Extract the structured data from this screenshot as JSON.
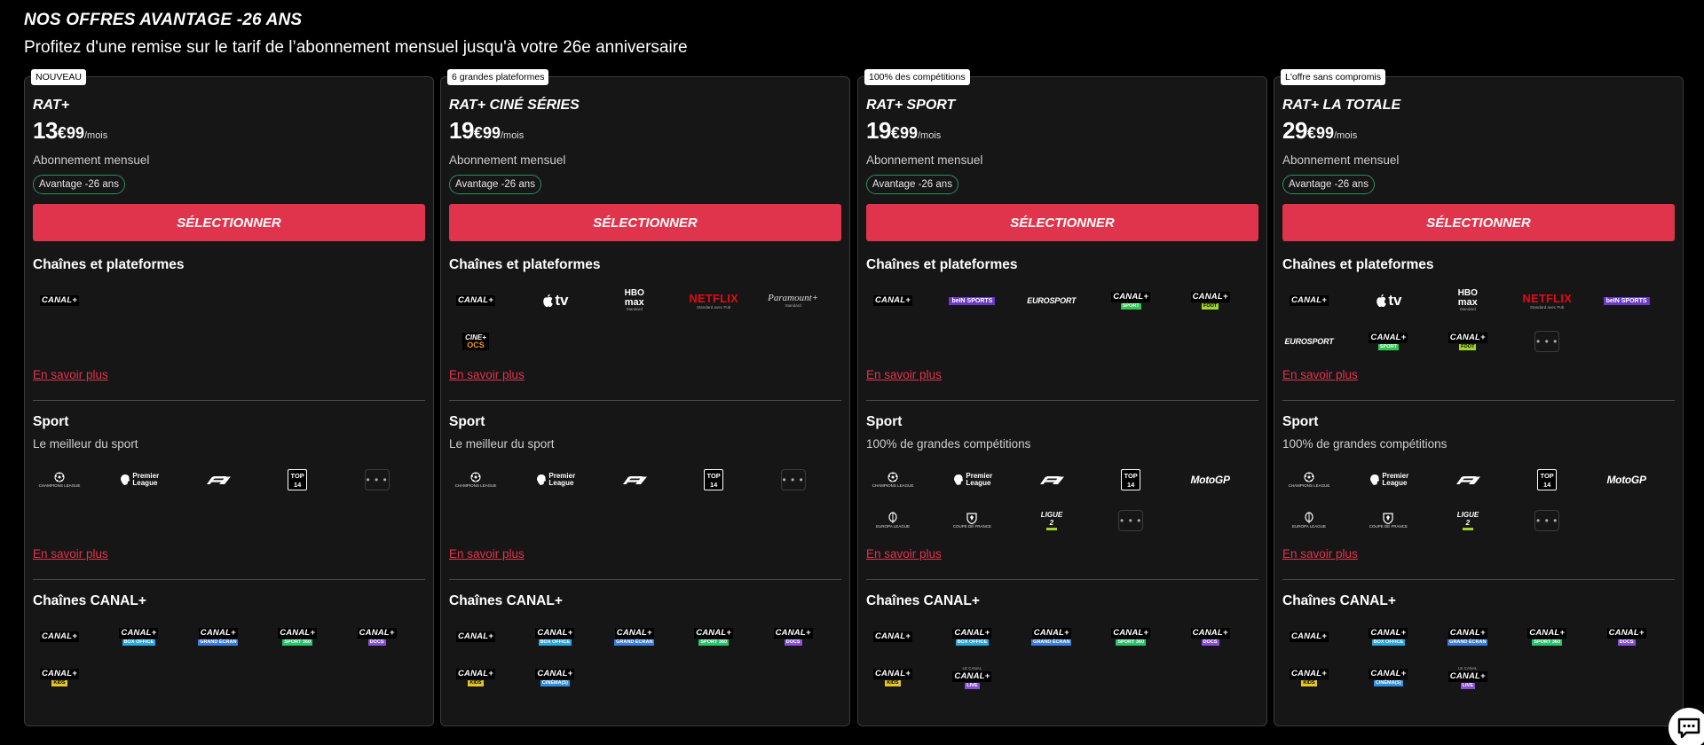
{
  "header": {
    "title": "NOS OFFRES AVANTAGE -26 ANS",
    "subtitle": "Profitez d'une remise sur le tarif de l’abonnement mensuel jusqu'à votre 26e anniversaire"
  },
  "common": {
    "billing": "Abonnement mensuel",
    "advantage": "Avantage -26 ans",
    "select": "SÉLECTIONNER",
    "channels_title": "Chaînes et plateformes",
    "sport_title": "Sport",
    "canal_title": "Chaînes CANAL+",
    "more": "En savoir plus",
    "price_unit": "€",
    "price_per": "/mois"
  },
  "plans": [
    {
      "badge": "NOUVEAU",
      "name": "RAT+",
      "price_int": "13",
      "price_dec": "99",
      "sport_sub": "Le meilleur du sport"
    },
    {
      "badge": "6 grandes plateformes",
      "name": "RAT+ CINÉ SÉRIES",
      "price_int": "19",
      "price_dec": "99",
      "sport_sub": "Le meilleur du sport"
    },
    {
      "badge": "100% des compétitions",
      "name": "RAT+ SPORT",
      "price_int": "19",
      "price_dec": "99",
      "sport_sub": "100% de grandes compétitions"
    },
    {
      "badge": "L'offre sans compromis",
      "name": "RAT+ LA TOTALE",
      "price_int": "29",
      "price_dec": "99",
      "sport_sub": "100% de grandes compétitions"
    }
  ],
  "logos": {
    "canal": "CANAL+",
    "box_office": "BOX OFFICE",
    "grand_ecran": "GRAND ÉCRAN",
    "sport360": "SPORT 360",
    "docs": "DOCS",
    "kids": "KIDS",
    "cinemas": "CINÉMA(S)",
    "live": "LIVE",
    "sport": "SPORT",
    "foot": "FOOT",
    "appletv": "tv",
    "hbo": "HBO",
    "max": "max",
    "standard": "Standard",
    "netflix": "NETFLIX",
    "netflix_sub": "Standard avec Pub",
    "paramount": "Paramount+",
    "ocs_top": "CINE+",
    "ocs": "OCS",
    "beinsports": "beIN SPORTS",
    "eurosport": "EUROSPORT",
    "champions": "CHAMPIONS LEAGUE",
    "premier": "Premier League",
    "f1": "F1",
    "top14": "TOP 14",
    "motogp": "MotoGP",
    "europa": "EUROPA LEAGUE",
    "coupe": "COUPE DE FRANCE",
    "ligue2": "LIGUE 2",
    "le_canal": "LE CANAL",
    "more_dots": "• • •"
  },
  "colors": {
    "accent": "#e0344c",
    "advantage_border": "#2d8f5a",
    "box_office": "#2aa6e0",
    "grand_ecran": "#3b7ddd",
    "sport360": "#27c46a",
    "docs": "#8a4fd9",
    "kids": "#e8c51f",
    "cinemas": "#2f8fe0",
    "sport": "#2cc84f",
    "foot": "#9ed32b"
  }
}
